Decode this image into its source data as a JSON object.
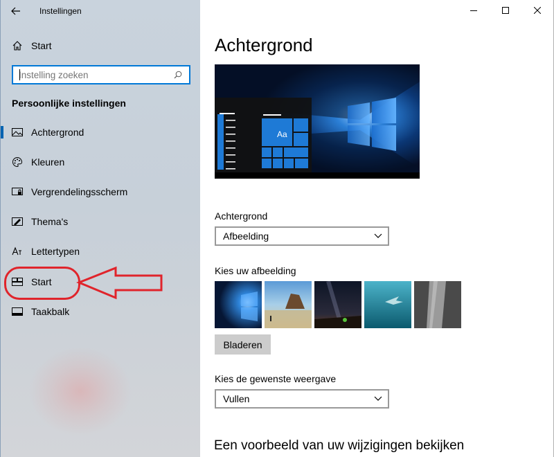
{
  "window": {
    "app_title": "Instellingen",
    "controls": [
      "minimize-icon",
      "maximize-icon",
      "close-icon"
    ]
  },
  "sidebar": {
    "home_label": "Start",
    "search": {
      "placeholder": "Instelling zoeken",
      "value": ""
    },
    "section_heading": "Persoonlijke instellingen",
    "items": [
      {
        "label": "Achtergrond",
        "icon": "picture-icon",
        "selected": true
      },
      {
        "label": "Kleuren",
        "icon": "palette-icon",
        "selected": false
      },
      {
        "label": "Vergrendelingsscherm",
        "icon": "lock-screen-icon",
        "selected": false
      },
      {
        "label": "Thema's",
        "icon": "brush-icon",
        "selected": false
      },
      {
        "label": "Lettertypen",
        "icon": "font-icon",
        "selected": false
      },
      {
        "label": "Start",
        "icon": "start-tiles-icon",
        "selected": false
      },
      {
        "label": "Taakbalk",
        "icon": "taskbar-icon",
        "selected": false
      }
    ],
    "annotation_color": "#e0242b"
  },
  "main": {
    "title": "Achtergrond",
    "preview": {
      "tile_label": "Aa"
    },
    "background_label": "Achtergrond",
    "background_value": "Afbeelding",
    "choose_picture_label": "Kies uw afbeelding",
    "browse_label": "Bladeren",
    "fit_label": "Kies de gewenste weergave",
    "fit_value": "Vullen",
    "preview_changes_heading": "Een voorbeeld van uw wijzigingen bekijken"
  },
  "colors": {
    "accent": "#0078d7",
    "selection_bar": "#0063b1"
  }
}
